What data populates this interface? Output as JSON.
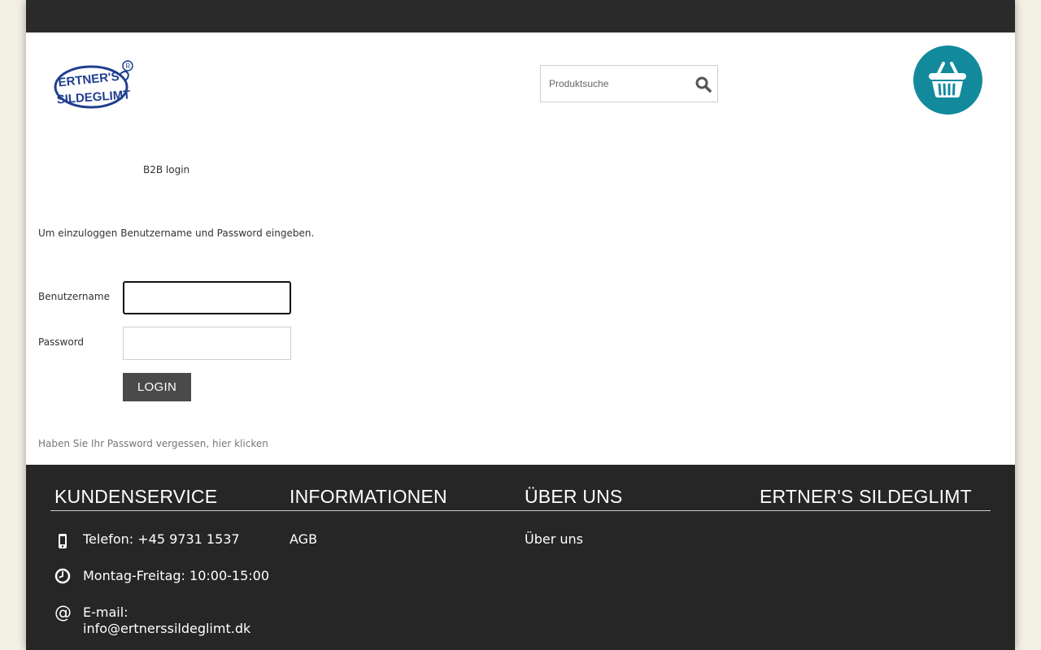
{
  "header": {
    "logo_alt": "ERTNER'S SILDEGLIMT",
    "search": {
      "placeholder": "Produktsuche",
      "value": ""
    },
    "icons": {
      "search": "search-icon",
      "cart": "basket-icon"
    },
    "cart_color": "#128a9c"
  },
  "nav": {
    "b2b_login": "B2B login"
  },
  "login": {
    "intro": "Um einzuloggen Benutzername und Password eingeben.",
    "username_label": "Benutzername",
    "username_value": "",
    "password_label": "Password",
    "password_value": "",
    "submit_label": "Login",
    "forgot_link": "Haben Sie Ihr Password vergessen, hier klicken"
  },
  "footer": {
    "columns": [
      {
        "heading": "Kundenservice"
      },
      {
        "heading": "Informationen"
      },
      {
        "heading": "Über uns"
      },
      {
        "heading": "Ertner's Sildeglimt"
      }
    ],
    "contact": {
      "phone": "Telefon: +45 9731 1537",
      "hours": "Montag-Freitag: 10:00-15:00",
      "email_label": "E-mail:",
      "email": "info@ertnerssildeglimt.dk",
      "icons": [
        "phone-icon",
        "clock-icon",
        "at-icon"
      ]
    },
    "info_links": [
      "AGB"
    ],
    "about_links": [
      "Über uns"
    ]
  },
  "colors": {
    "topbar": "#2a2a2a",
    "footer": "#262626",
    "button": "#4a4a4a",
    "accent": "#128a9c"
  }
}
